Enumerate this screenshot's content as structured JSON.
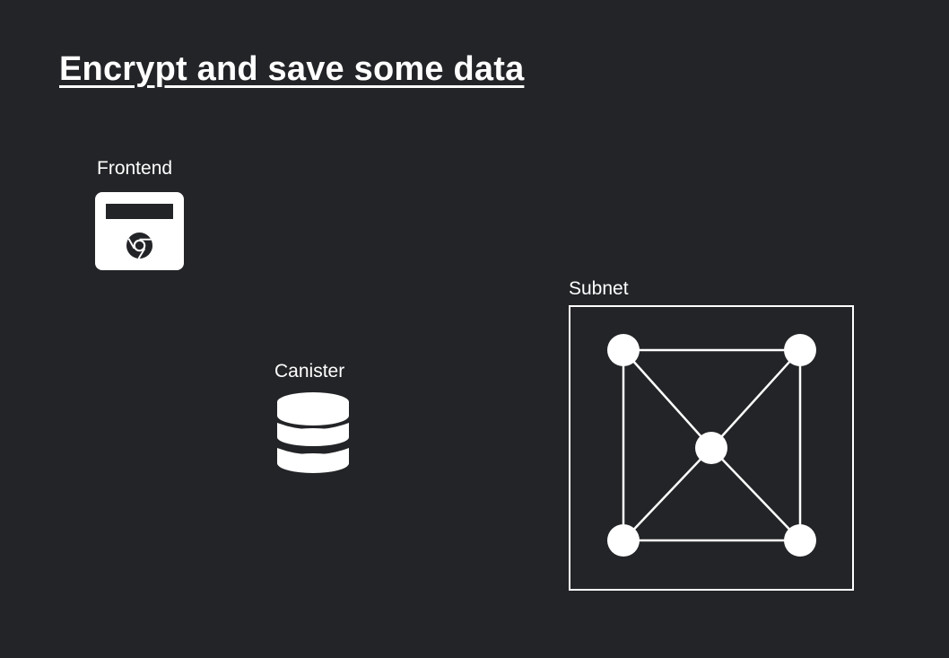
{
  "title": "Encrypt and save some data",
  "nodes": {
    "frontend": {
      "label": "Frontend",
      "icon": "browser-window-icon",
      "inner_icon": "chrome-icon"
    },
    "canister": {
      "label": "Canister",
      "icon": "database-icon"
    },
    "subnet": {
      "label": "Subnet",
      "icon": "network-graph-icon",
      "node_count": 5
    }
  },
  "colors": {
    "background": "#232427",
    "foreground": "#ffffff"
  }
}
